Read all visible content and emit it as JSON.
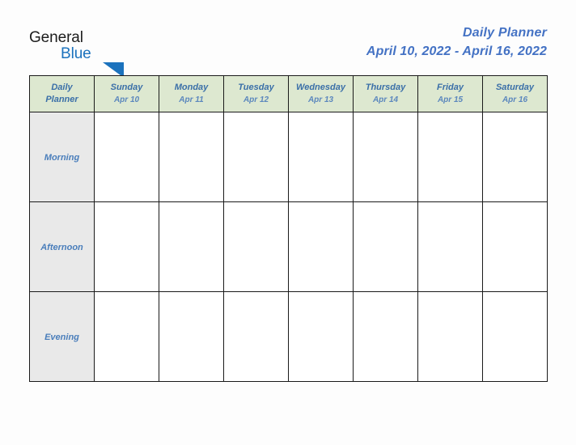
{
  "brand": {
    "name_part1": "General",
    "name_part2": "Blue",
    "triangle_icon": "blue-triangle-icon",
    "triangle_color": "#1b72bd"
  },
  "header": {
    "title": "Daily Planner",
    "date_range": "April 10, 2022 - April 16, 2022"
  },
  "colors": {
    "header_row_background": "#dde8d0",
    "row_label_background": "#e9e9e9",
    "cell_background": "#ffffff",
    "grid_line": "#1a1a1a",
    "title_blue": "#4472c4",
    "header_text_blue": "#3a6fa8",
    "date_text_blue": "#5b87bd",
    "row_label_blue": "#4a7ebb",
    "page_background": "#fdfdfd"
  },
  "table": {
    "corner": {
      "line1": "Daily",
      "line2": "Planner"
    },
    "columns": [
      {
        "day": "Sunday",
        "date": "Apr 10"
      },
      {
        "day": "Monday",
        "date": "Apr 11"
      },
      {
        "day": "Tuesday",
        "date": "Apr 12"
      },
      {
        "day": "Wednesday",
        "date": "Apr 13"
      },
      {
        "day": "Thursday",
        "date": "Apr 14"
      },
      {
        "day": "Friday",
        "date": "Apr 15"
      },
      {
        "day": "Saturday",
        "date": "Apr 16"
      }
    ],
    "rows": [
      {
        "label": "Morning",
        "cells": [
          "",
          "",
          "",
          "",
          "",
          "",
          ""
        ]
      },
      {
        "label": "Afternoon",
        "cells": [
          "",
          "",
          "",
          "",
          "",
          "",
          ""
        ]
      },
      {
        "label": "Evening",
        "cells": [
          "",
          "",
          "",
          "",
          "",
          "",
          ""
        ]
      }
    ]
  }
}
